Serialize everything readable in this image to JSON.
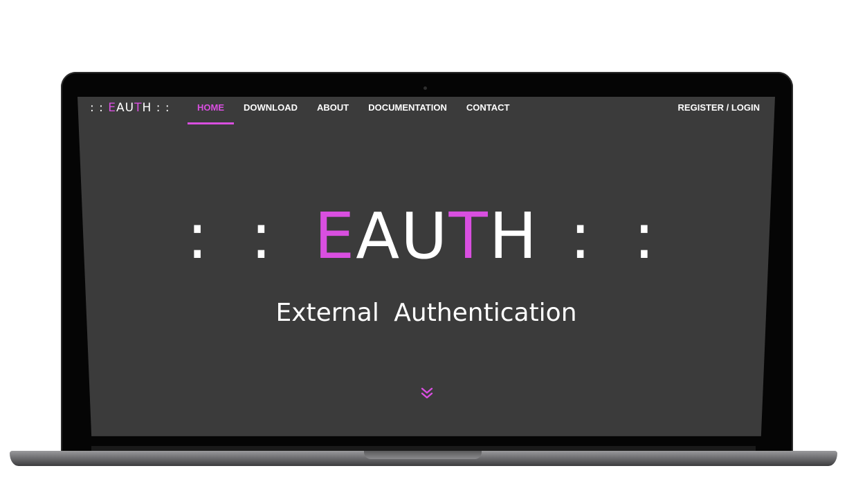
{
  "accent_color": "#d94fe0",
  "brand": {
    "prefix": ": : ",
    "letters": [
      "E",
      "A",
      "U",
      "T",
      "H"
    ],
    "suffix": " : :"
  },
  "nav": {
    "items": [
      {
        "label": "HOME",
        "active": true
      },
      {
        "label": "DOWNLOAD",
        "active": false
      },
      {
        "label": "ABOUT",
        "active": false
      },
      {
        "label": "DOCUMENTATION",
        "active": false
      },
      {
        "label": "CONTACT",
        "active": false
      }
    ],
    "right_label": "REGISTER / LOGIN"
  },
  "hero": {
    "title_prefix": ": : ",
    "title_letters": [
      "E",
      "A",
      "U",
      "T",
      "H"
    ],
    "title_suffix": " : :",
    "subtitle": "External  Authentication",
    "scroll_icon": "double-chevron-down-icon"
  }
}
